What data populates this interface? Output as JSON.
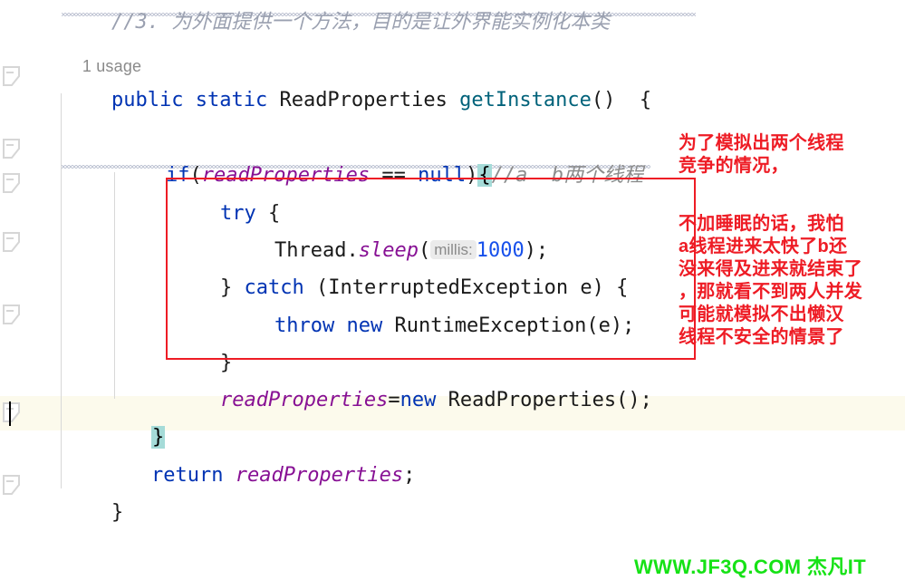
{
  "editor": {
    "language": "java",
    "colors": {
      "keyword": "#0033b3",
      "method": "#00627a",
      "field": "#871094",
      "number": "#1750eb",
      "comment": "#8c8c8c",
      "brace_match_highlight": "#a5dbd8",
      "current_line": "#fcfaec",
      "annotation_red": "#ee1c25",
      "watermark_green": "#16e216",
      "hint_background": "#ebebeb"
    },
    "usage_hint": "1 usage",
    "top_comment": "//3. 为外面提供一个方法，目的是让外界能实例化本类",
    "lines": {
      "signature": {
        "modifier_public": "public",
        "modifier_static": "static",
        "return_type": "ReadProperties",
        "method_name": "getInstance",
        "parens": "()",
        "open_brace": "{"
      },
      "if_line": {
        "keyword": "if",
        "open_paren": "(",
        "field": "readProperties",
        "operator": " == ",
        "null_literal": "null",
        "close_paren": ")",
        "brace": "{",
        "comment": "//a  b两个线程"
      },
      "try_line": {
        "keyword": "try",
        "brace": "{"
      },
      "sleep_line": {
        "class_name": "Thread",
        "dot": ".",
        "method": "sleep",
        "open_paren": "(",
        "param_hint": "millis:",
        "value": "1000",
        "tail": ");"
      },
      "catch_line": {
        "close_brace": "}",
        "keyword": "catch",
        "open_paren": " (",
        "exception_type": "InterruptedException",
        "var": " e",
        "close_paren": ")",
        "brace": " {"
      },
      "throw_line": {
        "keyword_throw": "throw",
        "keyword_new": "new",
        "exception": "RuntimeException(e);"
      },
      "try_close": "}",
      "assign_line": {
        "field": "readProperties",
        "equals": "=",
        "keyword_new": "new",
        "constructor": "ReadProperties();"
      },
      "if_close": "}",
      "return_line": {
        "keyword": "return",
        "field": "readProperties",
        "semicolon": ";"
      },
      "method_close": "}"
    }
  },
  "annotations": {
    "red_note_top": "为了模拟出两个线程\n竞争的情况，",
    "red_note_bottom": "不加睡眠的话，我怕\na线程进来太快了b还\n没来得及进来就结束了\n，那就看不到两人并发\n可能就模拟不出懒汉\n线程不安全的情景了",
    "red_box_label": "highlight-rectangle"
  },
  "watermark": {
    "text": "WWW.JF3Q.COM 杰凡IT"
  },
  "gutter": {
    "icon_name": "code-fold-icon",
    "icon_count": 7
  }
}
